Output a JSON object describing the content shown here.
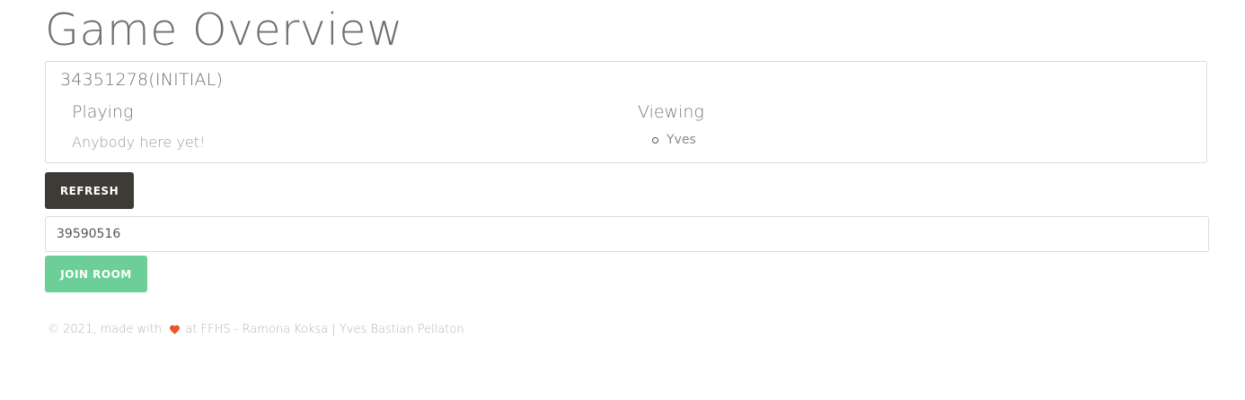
{
  "page": {
    "title": "Game Overview"
  },
  "room": {
    "title": "34351278(INITIAL)",
    "playing": {
      "heading": "Playing",
      "empty_text": "Anybody here yet!"
    },
    "viewing": {
      "heading": "Viewing",
      "viewers": [
        "Yves"
      ]
    }
  },
  "actions": {
    "refresh_label": "REFRESH",
    "room_input_value": "39590516",
    "join_label": "JOIN ROOM"
  },
  "footer": {
    "prefix": "© 2021, made with",
    "heart_icon": "heart-icon",
    "suffix": "at FFHS - Ramona Koksa | Yves Bastian Pellaton"
  },
  "colors": {
    "refresh_button": "#3e3a35",
    "join_button": "#6ccf97",
    "heart": "#e8562a"
  }
}
